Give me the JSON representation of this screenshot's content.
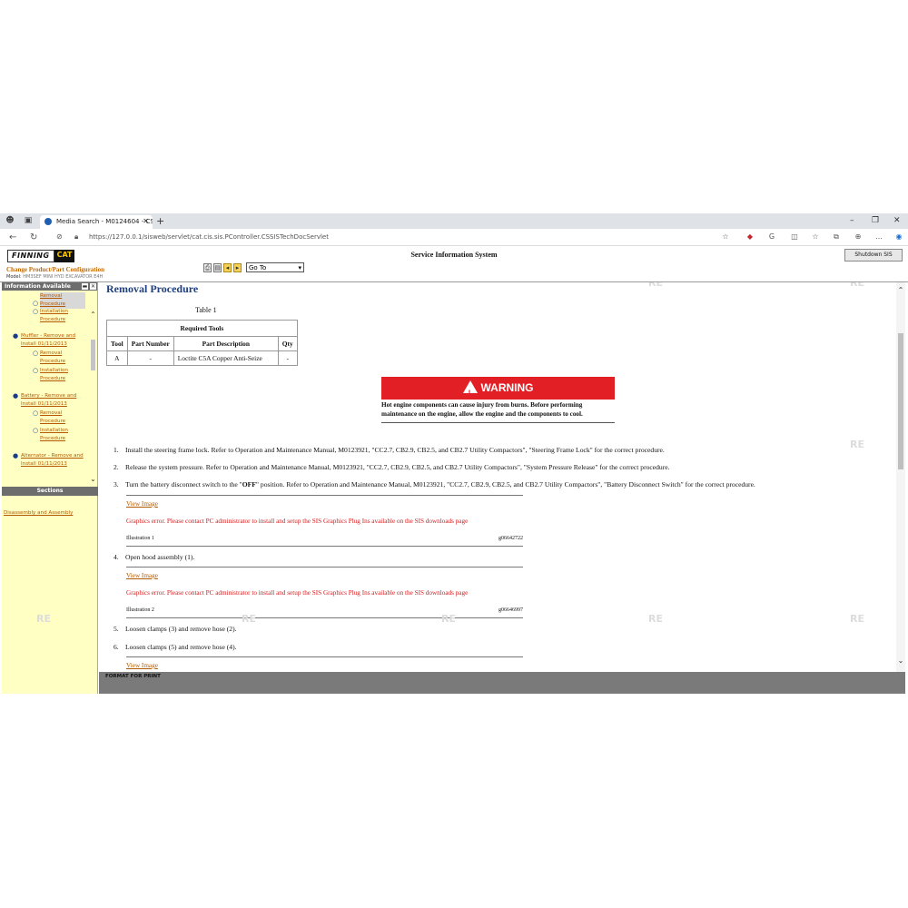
{
  "browser": {
    "tab_title": "Media Search - M0124604 - CS...",
    "url": "https://127.0.0.1/sisweb/servlet/cat.cis.sis.PController.CSSISTechDocServlet"
  },
  "header": {
    "logo_finning": "FINNING",
    "logo_cat": "CAT",
    "change_config": "Change Product/Part Configuration",
    "model_label": "Model:",
    "model_value": "HM3SEF MINI HYD EXCAVATOR E4H",
    "goto_value": "Go To",
    "system_title": "Service Information System",
    "shutdown_label": "Shutdown SIS"
  },
  "left_pane": {
    "title": "Information Available",
    "items": [
      {
        "text": "Removal Procedure",
        "level": 2
      },
      {
        "text": "Installation Procedure",
        "level": 2
      },
      {
        "text": "Muffler - Remove and Install 01/11/2013",
        "level": 1
      },
      {
        "text": "Removal Procedure",
        "level": 2
      },
      {
        "text": "Installation Procedure",
        "level": 2
      },
      {
        "text": "Battery - Remove and Install 01/11/2013",
        "level": 1
      },
      {
        "text": "Removal Procedure",
        "level": 2
      },
      {
        "text": "Installation Procedure",
        "level": 2
      },
      {
        "text": "Alternator - Remove and Install 01/11/2013",
        "level": 1
      }
    ],
    "sections_label": "Sections",
    "section_link": "Disassembly and Assembly"
  },
  "main": {
    "title": "Removal Procedure",
    "table_caption": "Table 1",
    "table_title": "Required Tools",
    "columns": [
      "Tool",
      "Part Number",
      "Part Description",
      "Qty"
    ],
    "rows": [
      [
        "A",
        "-",
        "Loctite C5A Copper Anti-Seize",
        "-"
      ]
    ],
    "warning_label": "WARNING",
    "warning_text": "Hot engine components can cause injury from burns. Before performing maintenance on the engine, allow the engine and the components to cool.",
    "steps": [
      {
        "n": "1.",
        "text": "Install the steering frame lock. Refer to Operation and Maintenance Manual, M0123921, \"CC2.7, CB2.9, CB2.5, and CB2.7 Utility Compactors\", \"Steering Frame Lock\" for the correct procedure."
      },
      {
        "n": "2.",
        "text": "Release the system pressure. Refer to Operation and Maintenance Manual, M0123921, \"CC2.7, CB2.9, CB2.5, and CB2.7 Utility Compactors\", \"System Pressure Release\" for the correct procedure."
      },
      {
        "n": "3.",
        "pre": "Turn the battery disconnect switch to the \"",
        "bold": "OFF",
        "post": "\" position. Refer to Operation and Maintenance Manual, M0123921, \"CC2.7, CB2.9, CB2.5, and CB2.7 Utility Compactors\", \"Battery Disconnect Switch\" for the correct procedure."
      },
      {
        "n": "4.",
        "text": "Open hood assembly (1)."
      },
      {
        "n": "5.",
        "text": "Loosen clamps (3) and remove hose (2)."
      },
      {
        "n": "6.",
        "text": "Loosen clamps (5) and remove hose (4)."
      }
    ],
    "view_image": "View Image",
    "graphics_error": "Graphics error. Please contact PC administrator to install and setup the SIS Graphics Plug Ins available on the SIS downloads page",
    "illustrations": [
      {
        "label": "Illustration 1",
        "code": "g06642722"
      },
      {
        "label": "Illustration 2",
        "code": "g06646997"
      }
    ]
  },
  "footer": {
    "format_print": "FORMAT FOR PRINT"
  },
  "watermark": "RE",
  "colors": {
    "accent_blue": "#1f3f7f",
    "link_orange": "#b35a00",
    "warning_red": "#e31f26",
    "pane_yellow": "#ffffc4"
  }
}
